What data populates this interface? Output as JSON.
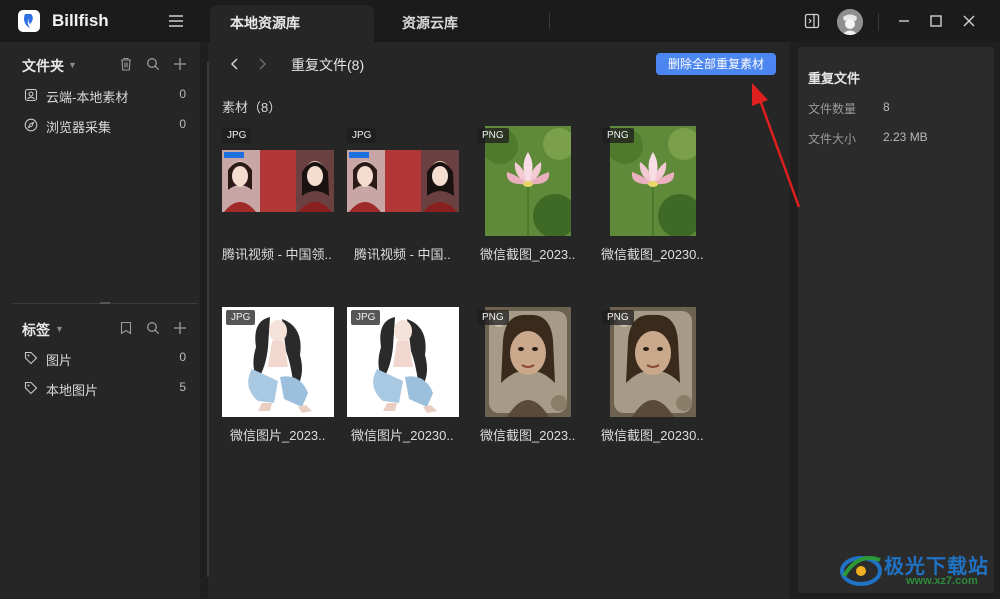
{
  "app": {
    "name": "Billfish"
  },
  "tabs": [
    {
      "label": "本地资源库"
    },
    {
      "label": "资源云库"
    }
  ],
  "sidebar": {
    "folders_title": "文件夹",
    "folders": [
      {
        "label": "云端-本地素材",
        "count": "0",
        "icon": "cloud-folder-icon"
      },
      {
        "label": "浏览器采集",
        "count": "0",
        "icon": "compass-icon"
      }
    ],
    "tags_title": "标签",
    "tags": [
      {
        "label": "图片",
        "count": "0",
        "icon": "tag-icon"
      },
      {
        "label": "本地图片",
        "count": "5",
        "icon": "tag-icon"
      }
    ]
  },
  "main": {
    "breadcrumb": "重复文件(8)",
    "delete_button": "删除全部重复素材",
    "section_label": "素材（8）",
    "items": [
      {
        "type": "JPG",
        "caption": "腾讯视频 - 中国领..",
        "image": "video-frame"
      },
      {
        "type": "JPG",
        "caption": "腾讯视频 - 中国..",
        "image": "video-frame"
      },
      {
        "type": "PNG",
        "caption": "微信截图_2023..",
        "image": "lotus"
      },
      {
        "type": "PNG",
        "caption": "微信截图_20230..",
        "image": "lotus"
      },
      {
        "type": "JPG",
        "caption": "微信图片_2023..",
        "image": "illustration"
      },
      {
        "type": "JPG",
        "caption": "微信图片_20230..",
        "image": "illustration"
      },
      {
        "type": "PNG",
        "caption": "微信截图_2023..",
        "image": "portrait"
      },
      {
        "type": "PNG",
        "caption": "微信截图_20230..",
        "image": "portrait"
      }
    ]
  },
  "details": {
    "title": "重复文件",
    "file_count_label": "文件数量",
    "file_count": "8",
    "file_size_label": "文件大小",
    "file_size": "2.23 MB"
  },
  "watermark": {
    "text": "极光下载站",
    "url": "www.xz7.com"
  },
  "colors": {
    "accent": "#4c86f0",
    "annotation_arrow": "#e02020"
  }
}
